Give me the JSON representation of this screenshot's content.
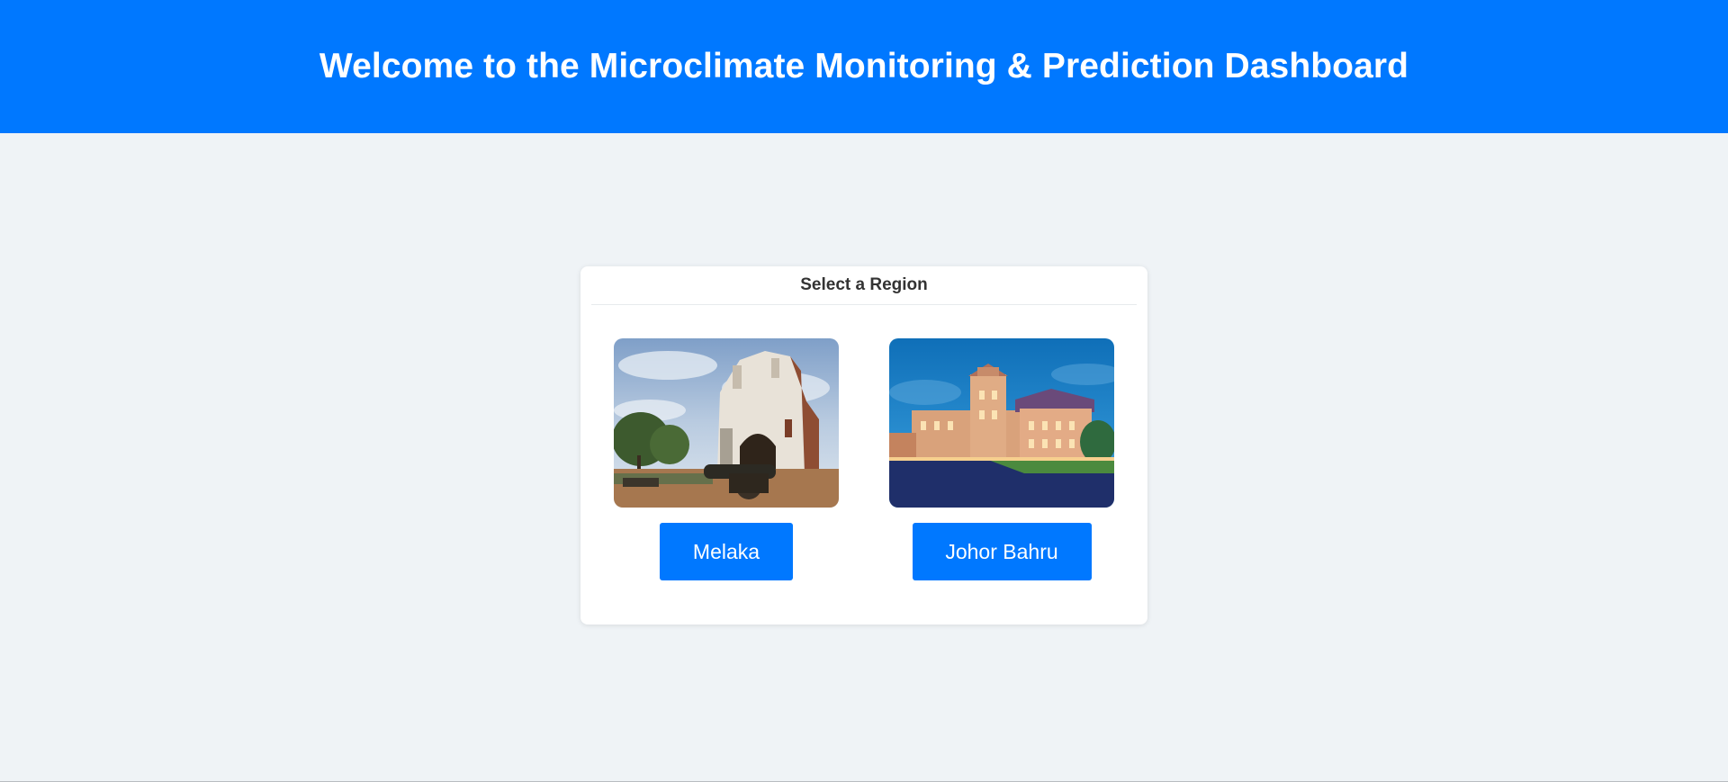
{
  "header": {
    "title": "Welcome to the Microclimate Monitoring & Prediction Dashboard"
  },
  "region_selector": {
    "title": "Select a Region",
    "regions": [
      {
        "label": "Melaka",
        "image": "a-famosa-fortress-photo"
      },
      {
        "label": "Johor Bahru",
        "image": "sultan-ibrahim-building-photo"
      }
    ]
  },
  "colors": {
    "header_bg": "#0078ff",
    "page_bg": "#eff3f6",
    "button_bg": "#0078ff",
    "card_bg": "#ffffff"
  }
}
